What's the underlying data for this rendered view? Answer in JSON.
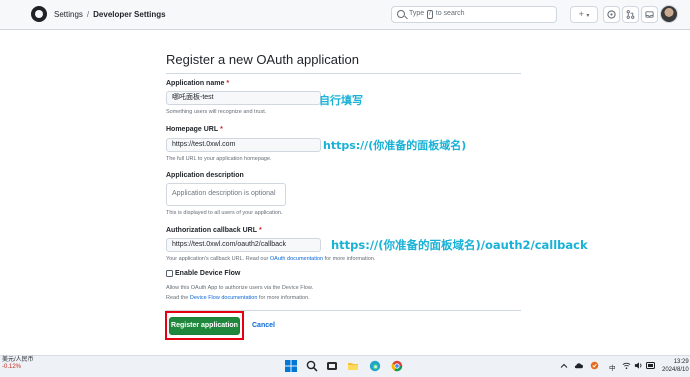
{
  "header": {
    "breadcrumb_root": "Settings",
    "breadcrumb_separator": "/",
    "breadcrumb_current": "Developer Settings",
    "search_prefix": "Type",
    "search_key": "/",
    "search_suffix": "to search",
    "new_button": "+",
    "new_caret": "▾"
  },
  "form": {
    "title": "Register a new OAuth application",
    "required_mark": "*",
    "app_name": {
      "label": "Application name",
      "value": "哪吒面板-test",
      "hint": "Something users will recognize and trust."
    },
    "homepage": {
      "label": "Homepage URL",
      "value": "https://test.0xwl.com",
      "hint": "The full URL to your application homepage."
    },
    "description": {
      "label": "Application description",
      "placeholder": "Application description is optional",
      "hint": "This is displayed to all users of your application."
    },
    "callback": {
      "label": "Authorization callback URL",
      "value": "https://test.0xwl.com/oauth2/callback",
      "hint_prefix": "Your application's callback URL. Read our",
      "hint_link": "OAuth documentation",
      "hint_suffix": "for more information."
    },
    "device_flow": {
      "label": "Enable Device Flow",
      "checked": false,
      "hint_line1": "Allow this OAuth App to authorize users via the Device Flow.",
      "hint_prefix": "Read the",
      "hint_link": "Device Flow documentation",
      "hint_suffix": "for more information."
    },
    "register_label": "Register application",
    "cancel_label": "Cancel"
  },
  "annotations": {
    "app_name": "自行填写",
    "homepage": "https://(你准备的面板域名)",
    "callback": "https://(你准备的面板域名)/oauth2/callback",
    "color": "#19b2d6",
    "highlight_color": "#e60012"
  },
  "taskbar": {
    "fx_pair": "美元/人民币",
    "fx_change": "-0.12%",
    "ime": "中",
    "time": "13:29",
    "date": "2024/8/10"
  },
  "colors": {
    "primary": "#1f883d",
    "link": "#0969da",
    "required": "#cf222e"
  }
}
